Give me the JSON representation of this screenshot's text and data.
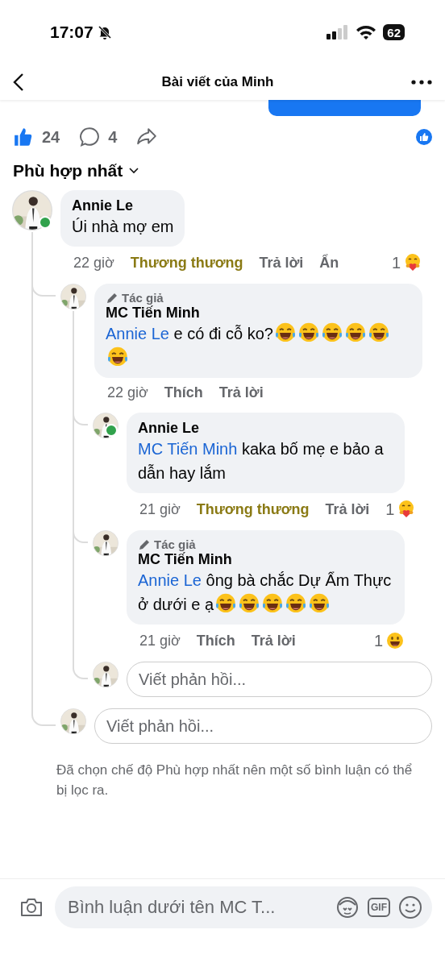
{
  "status_bar": {
    "time": "17:07",
    "silent": true,
    "battery": "62"
  },
  "header": {
    "title": "Bài viết của Minh"
  },
  "stats": {
    "likes": "24",
    "comments": "4"
  },
  "sort": {
    "label": "Phù hợp nhất"
  },
  "comments": [
    {
      "kind": "comment",
      "author": "Annie Le",
      "online": true,
      "body": [
        {
          "kind": "text",
          "text": "Úi nhà mợ em"
        }
      ],
      "time": "22 giờ",
      "reaction": {
        "label": "Thương thương",
        "selected": true
      },
      "reply": "Trả lời",
      "hide": "Ẩn",
      "reaction_count": {
        "count": "1",
        "kind": "care"
      },
      "children": [
        {
          "kind": "comment",
          "author": "MC Tiến Minh",
          "badge": "Tác giả",
          "online": false,
          "body": [
            {
              "kind": "mention",
              "text": "Annie Le"
            },
            {
              "kind": "text",
              "text": " e có đi cỗ ko?"
            },
            {
              "kind": "laughing-emoji"
            },
            {
              "kind": "laughing-emoji"
            },
            {
              "kind": "laughing-emoji"
            },
            {
              "kind": "laughing-emoji"
            },
            {
              "kind": "laughing-emoji"
            },
            {
              "kind": "laughing-emoji"
            }
          ],
          "time": "22 giờ",
          "reaction": {
            "label": "Thích",
            "selected": false
          },
          "reply": "Trả lời",
          "children": [
            {
              "kind": "comment",
              "author": "Annie Le",
              "online": true,
              "body": [
                {
                  "kind": "mention",
                  "text": "MC Tiến Minh"
                },
                {
                  "kind": "text",
                  "text": " kaka bố mẹ e bảo a dẫn hay lắm"
                }
              ],
              "time": "21 giờ",
              "reaction": {
                "label": "Thương thương",
                "selected": true
              },
              "reply": "Trả lời",
              "reaction_count": {
                "count": "1",
                "kind": "care"
              }
            },
            {
              "kind": "comment",
              "author": "MC Tiến Minh",
              "badge": "Tác giả",
              "online": false,
              "body": [
                {
                  "kind": "mention",
                  "text": "Annie Le"
                },
                {
                  "kind": "text",
                  "text": " ông bà chắc Dự Ẩm Thực ở dưới e ạ"
                },
                {
                  "kind": "laughing-emoji"
                },
                {
                  "kind": "laughing-emoji"
                },
                {
                  "kind": "laughing-emoji"
                },
                {
                  "kind": "laughing-emoji"
                },
                {
                  "kind": "laughing-emoji"
                }
              ],
              "time": "21 giờ",
              "reaction": {
                "label": "Thích",
                "selected": false
              },
              "reply": "Trả lời",
              "reaction_count": {
                "count": "1",
                "kind": "haha"
              }
            },
            {
              "kind": "reply-box",
              "placeholder": "Viết phản hồi..."
            }
          ]
        },
        {
          "kind": "reply-box",
          "placeholder": "Viết phản hồi..."
        }
      ]
    }
  ],
  "filter_note": "Đã chọn chế độ Phù hợp nhất nên một số bình luận có thể bị lọc ra.",
  "composer": {
    "placeholder": "Bình luận dưới tên MC T...",
    "gif_label": "GIF"
  }
}
